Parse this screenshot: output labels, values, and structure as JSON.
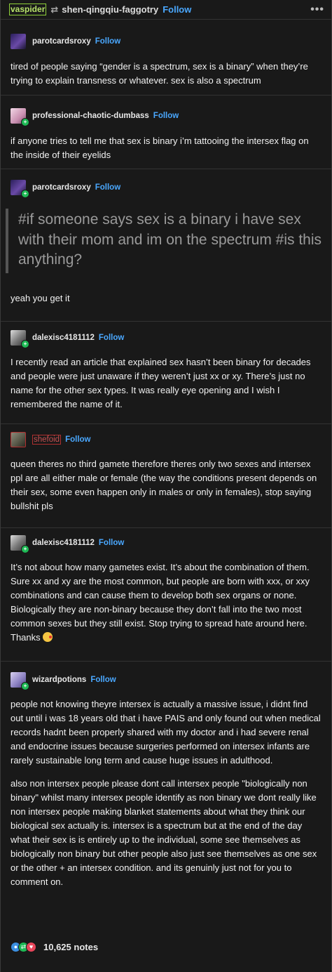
{
  "header": {
    "original_user": "vaspider",
    "reblogger": "shen-qingqiu-faggotry",
    "follow_label": "Follow"
  },
  "entries": [
    {
      "username": "parotcardsroxy",
      "follow_label": "Follow",
      "paragraphs": [
        "tired of people saying “gender is a spectrum, sex is a binary” when they’re trying to explain transness or whatever. sex is also a spectrum"
      ]
    },
    {
      "username": "professional-chaotic-dumbass",
      "follow_label": "Follow",
      "paragraphs": [
        "if anyone tries to tell me that sex is binary i’m tattooing the intersex flag on the inside of their eyelids"
      ]
    },
    {
      "username": "parotcardsroxy",
      "follow_label": "Follow",
      "quote": "#if someone says sex is a binary i have sex with their mom and im on the spectrum #is this anything?",
      "paragraphs": [
        "yeah you get it"
      ]
    },
    {
      "username": "dalexisc4181112",
      "follow_label": "Follow",
      "paragraphs": [
        "I recently read an article that explained sex hasn’t been binary for decades and people were just unaware if they weren’t just xx or xy. There’s just no name for the other sex types. It was really eye opening and I wish I remembered the name of it."
      ]
    },
    {
      "username": "shefoid",
      "follow_label": "Follow",
      "paragraphs": [
        "queen theres no third gamete therefore theres only two sexes and intersex ppl are all either male or female (the way the conditions present depends on their sex, some even happen only in males or only in females), stop saying bullshit pls"
      ]
    },
    {
      "username": "dalexisc4181112",
      "follow_label": "Follow",
      "paragraphs": [
        "It’s not about how many gametes exist. It’s about the combination of them. Sure xx and xy are the most common, but people are born with xxx, or xxy combinations and can cause them to develop both sex organs or none. Biologically they are non-binary because they don’t fall into the two most common sexes but they still exist. Stop trying to spread hate around here. Thanks"
      ]
    },
    {
      "username": "wizardpotions",
      "follow_label": "Follow",
      "paragraphs": [
        "people not knowing theyre intersex is actually a massive issue, i didnt find out until i was 18 years old that i have PAIS and only found out when medical records hadnt been properly shared with my doctor and i had severe renal and endocrine issues because surgeries performed on intersex infants are rarely sustainable long term and cause huge issues in adulthood.",
        "also non intersex people please dont call intersex people \"biologically non binary\" whilst many intersex people identify as non binary we dont really like non intersex people making blanket statements about what they think our biological sex actually is. intersex is a spectrum but at the end of the day what their sex is is entirely up to the individual, some see themselves as biologically non binary but other people also just see themselves as one sex or the other + an intersex condition. and its genuinly just not for you to comment on."
      ]
    }
  ],
  "footer": {
    "notes": "10,625 notes"
  },
  "colors": {
    "background": "#191919",
    "follow": "#4aa8ff",
    "badge": "#1eb955",
    "original_user_border": "#8fd13a",
    "shefoid_border": "#b03030"
  }
}
